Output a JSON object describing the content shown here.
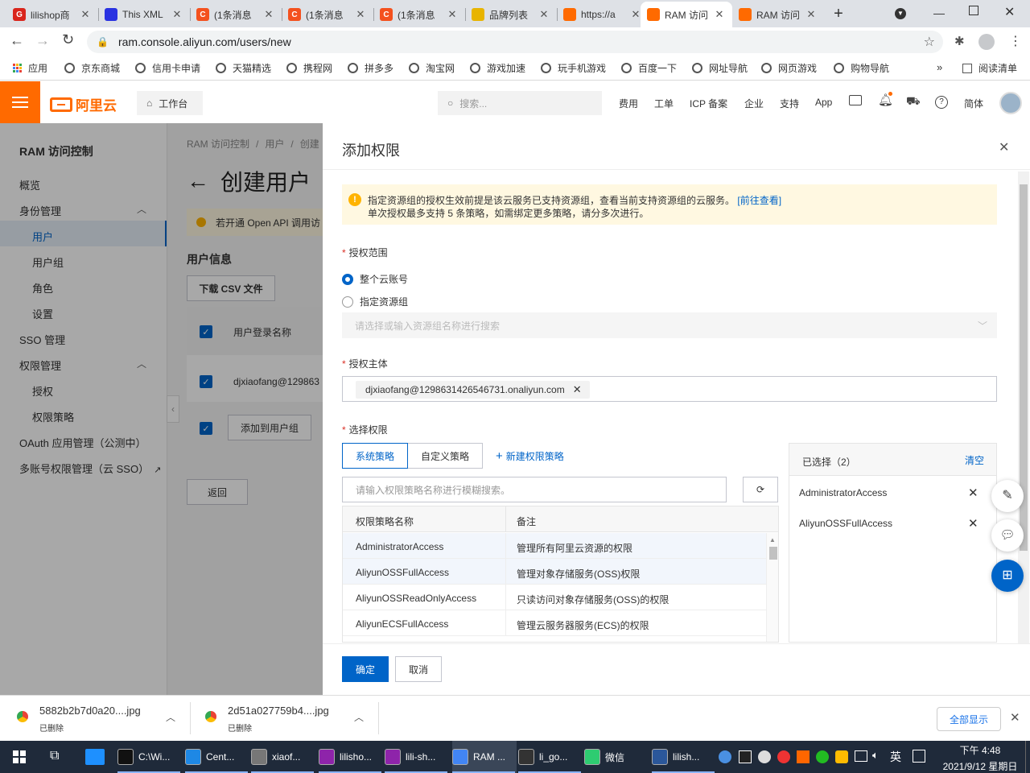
{
  "browser": {
    "tabs": [
      {
        "title": "lilishop商",
        "fav": "G",
        "color": "#d9251c"
      },
      {
        "title": "This XML",
        "fav": "",
        "color": "#2932e1"
      },
      {
        "title": "(1条消息",
        "fav": "C",
        "color": "#f4511e"
      },
      {
        "title": "(1条消息",
        "fav": "C",
        "color": "#f4511e"
      },
      {
        "title": "(1条消息",
        "fav": "C",
        "color": "#f4511e"
      },
      {
        "title": "品牌列表",
        "fav": "",
        "color": "#e8b400"
      },
      {
        "title": "https://a",
        "fav": "",
        "color": "#ff6a00"
      },
      {
        "title": "RAM 访问",
        "fav": "",
        "color": "#ff6a00"
      },
      {
        "title": "RAM 访问",
        "fav": "",
        "color": "#ff6a00"
      }
    ],
    "url": "ram.console.aliyun.com/users/new",
    "bookmarks": [
      "应用",
      "京东商城",
      "信用卡申请",
      "天猫精选",
      "携程网",
      "拼多多",
      "淘宝网",
      "游戏加速",
      "玩手机游戏",
      "百度一下",
      "网址导航",
      "网页游戏",
      "购物导航"
    ],
    "more": "»",
    "reading_list": "阅读清单"
  },
  "header": {
    "logo": "阿里云",
    "workbench": "工作台",
    "search_placeholder": "搜索...",
    "nav": [
      "费用",
      "工单",
      "ICP 备案",
      "企业",
      "支持",
      "App"
    ],
    "lang": "简体"
  },
  "sidebar": {
    "title": "RAM 访问控制",
    "items": [
      "概览",
      "身份管理",
      "用户",
      "用户组",
      "角色",
      "设置",
      "SSO 管理",
      "权限管理",
      "授权",
      "权限策略",
      "OAuth 应用管理（公测中）",
      "多账号权限管理（云 SSO）"
    ]
  },
  "main": {
    "breadcrumb": [
      "RAM 访问控制",
      "用户",
      "创建"
    ],
    "title": "创建用户",
    "notice": "若开通 Open API 调用访",
    "section": "用户信息",
    "download_csv": "下载 CSV 文件",
    "col_login": "用户登录名称",
    "row_user": "djxiaofang@129863",
    "add_to_group": "添加到用户组",
    "back": "返回"
  },
  "drawer": {
    "title": "添加权限",
    "notice_line1": "指定资源组的授权生效前提是该云服务已支持资源组，查看当前支持资源组的云服务。",
    "notice_link": "[前往查看]",
    "notice_line2": "单次授权最多支持 5 条策略，如需绑定更多策略，请分多次进行。",
    "scope_label": "授权范围",
    "scope_options": [
      "整个云账号",
      "指定资源组"
    ],
    "scope_selected": 0,
    "rg_placeholder": "请选择或输入资源组名称进行搜索",
    "principal_label": "授权主体",
    "principal_tag": "djxiaofang@1298631426546731.onaliyun.com",
    "perm_label": "选择权限",
    "tabs": [
      "系统策略",
      "自定义策略"
    ],
    "new_policy": "新建权限策略",
    "search_placeholder": "请输入权限策略名称进行模糊搜索。",
    "table_headers": [
      "权限策略名称",
      "备注"
    ],
    "rows": [
      {
        "name": "AdministratorAccess",
        "note": "管理所有阿里云资源的权限",
        "selected": true
      },
      {
        "name": "AliyunOSSFullAccess",
        "note": "管理对象存储服务(OSS)权限",
        "selected": true
      },
      {
        "name": "AliyunOSSReadOnlyAccess",
        "note": "只读访问对象存储服务(OSS)的权限",
        "selected": false
      },
      {
        "name": "AliyunECSFullAccess",
        "note": "管理云服务器服务(ECS)的权限",
        "selected": false
      }
    ],
    "selected_title": "已选择（2）",
    "clear": "清空",
    "selected_items": [
      "AdministratorAccess",
      "AliyunOSSFullAccess"
    ],
    "confirm": "确定",
    "cancel": "取消"
  },
  "downloads": {
    "items": [
      {
        "name": "5882b2b7d0a20....jpg",
        "status": "已删除"
      },
      {
        "name": "2d51a027759b4....jpg",
        "status": "已删除"
      }
    ],
    "show_all": "全部显示"
  },
  "taskbar": {
    "apps": [
      "C:\\Wi...",
      "Cent...",
      "xiaof...",
      "lilisho...",
      "lili-sh...",
      "RAM ...",
      "li_go...",
      "微信",
      "lilish..."
    ],
    "ime": "英",
    "time": "下午 4:48",
    "date": "2021/9/12 星期日"
  },
  "colors": {
    "brand": "#ff6a00",
    "primary": "#0064c8",
    "notice_bg": "#fff8e1"
  }
}
